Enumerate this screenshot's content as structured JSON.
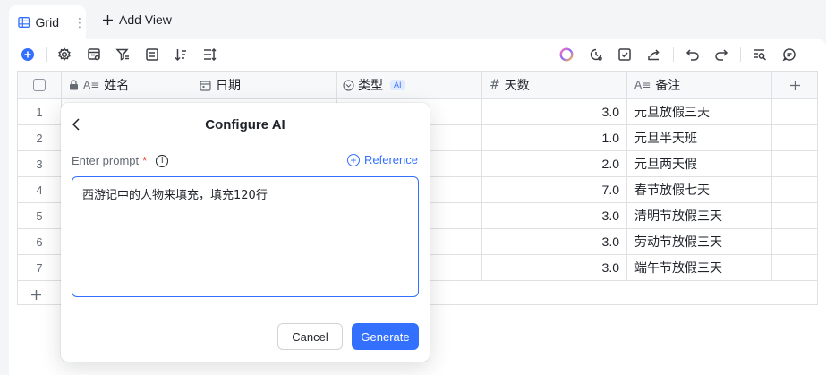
{
  "tabs": {
    "active_label": "Grid",
    "more_icon": "more-vertical-icon",
    "add_view_label": "Add View"
  },
  "toolbar": {
    "icons": [
      "add-record-icon",
      "settings-icon",
      "field-config-icon",
      "filter-icon",
      "group-icon",
      "sort-icon",
      "row-height-icon",
      "ai-assistant-icon",
      "history-icon",
      "checklist-icon",
      "share-icon",
      "undo-icon",
      "redo-icon",
      "search-icon",
      "comment-icon"
    ]
  },
  "grid": {
    "columns": [
      {
        "label": "姓名",
        "type_icon": "Aa"
      },
      {
        "label": "日期",
        "type_icon": "date"
      },
      {
        "label": "类型",
        "type_icon": "select",
        "badge": "AI"
      },
      {
        "label": "天数",
        "type_icon": "#"
      },
      {
        "label": "备注",
        "type_icon": "Aa"
      }
    ],
    "rows": [
      {
        "n": "1",
        "days": "3.0",
        "note": "元旦放假三天"
      },
      {
        "n": "2",
        "days": "1.0",
        "note": "元旦半天班"
      },
      {
        "n": "3",
        "days": "2.0",
        "note": "元旦两天假"
      },
      {
        "n": "4",
        "days": "7.0",
        "note": "春节放假七天"
      },
      {
        "n": "5",
        "days": "3.0",
        "note": "清明节放假三天"
      },
      {
        "n": "6",
        "days": "3.0",
        "note": "劳动节放假三天"
      },
      {
        "n": "7",
        "days": "3.0",
        "note": "端午节放假三天"
      }
    ]
  },
  "modal": {
    "title": "Configure AI",
    "prompt_label": "Enter prompt",
    "required_mark": "*",
    "reference_label": "Reference",
    "prompt_value": "西游记中的人物来填充，填充120行",
    "cancel_label": "Cancel",
    "generate_label": "Generate"
  },
  "colors": {
    "accent": "#3370ff",
    "required": "#f54a45"
  }
}
